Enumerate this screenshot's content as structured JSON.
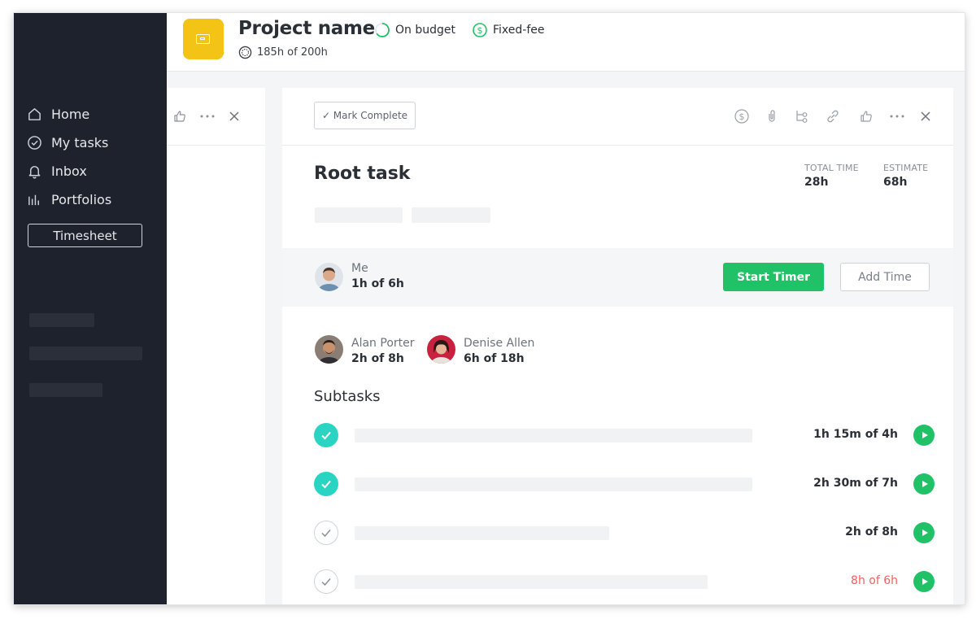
{
  "header": {
    "project_name": "Project name",
    "budget_status": "On budget",
    "fee_type": "Fixed-fee",
    "hours_summary": "185h of 200h"
  },
  "sidebar": {
    "items": [
      {
        "label": "Home",
        "icon": "home-icon"
      },
      {
        "label": "My tasks",
        "icon": "check-circle-icon"
      },
      {
        "label": "Inbox",
        "icon": "bell-icon"
      },
      {
        "label": "Portfolios",
        "icon": "bar-chart-icon"
      }
    ],
    "timesheet_label": "Timesheet"
  },
  "task": {
    "mark_complete_label": "✓ Mark Complete",
    "title": "Root task",
    "total_time_label": "TOTAL TIME",
    "total_time_value": "28h",
    "estimate_label": "ESTIMATE",
    "estimate_value": "68h"
  },
  "me": {
    "name": "Me",
    "hours": "1h of 6h",
    "start_timer_label": "Start Timer",
    "add_time_label": "Add Time"
  },
  "assignees": [
    {
      "name": "Alan Porter",
      "hours": "2h of 8h"
    },
    {
      "name": "Denise Allen",
      "hours": "6h of 18h"
    }
  ],
  "subtasks_title": "Subtasks",
  "subtasks": [
    {
      "time": "1h 15m of 4h",
      "completed": true,
      "over_budget": false
    },
    {
      "time": "2h 30m of 7h",
      "completed": true,
      "over_budget": false
    },
    {
      "time": "2h of 8h",
      "completed": false,
      "over_budget": false
    },
    {
      "time": "8h of 6h",
      "completed": false,
      "over_budget": true
    }
  ],
  "colors": {
    "sidebar_bg": "#1e222c",
    "project_icon": "#f3c315",
    "accent_green": "#21c167",
    "done_teal": "#2ad4c2",
    "over_budget_red": "#f0605f"
  }
}
